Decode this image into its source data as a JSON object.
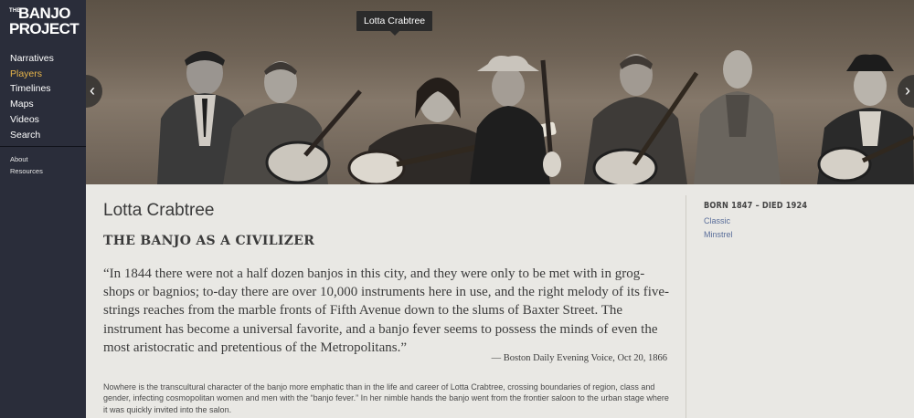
{
  "logo": {
    "the": "THE",
    "line1": "BANJO",
    "line2": "PROJECT"
  },
  "nav": [
    "Narratives",
    "Players",
    "Timelines",
    "Maps",
    "Videos",
    "Search"
  ],
  "nav_active": "Players",
  "subnav": [
    "About",
    "Resources"
  ],
  "banner": {
    "tooltip": "Lotta Crabtree",
    "prev_icon": "chevron-left-icon",
    "next_icon": "chevron-right-icon"
  },
  "player": {
    "name": "Lotta Crabtree",
    "section_title": "THE BANJO AS A CIVILIZER",
    "quote": "“In 1844 there were not a half dozen banjos in this city, and they were only to be met with in grog-shops or bagnios; to-day there are over 10,000 instruments here in use, and the right melody of its five-strings reaches from the marble fronts of Fifth Avenue down to the slums of Baxter Street. The instrument has become a universal favorite, and a banjo fever seems to possess the minds of even the most aristocratic and pretentious of the Metropolitans.”",
    "attribution": "— Boston Daily Evening Voice, Oct 20, 1866",
    "body": "Nowhere is the transcultural character of the banjo more emphatic than in the life and career of Lotta Crabtree, crossing boundaries of region, class and gender, infecting cosmopolitan women and men with the “banjo fever.” In her nimble hands the banjo went from the frontier saloon to the urban stage where it was quickly invited into the salon.",
    "dates": "BORN 1847 – DIED 1924",
    "tags": [
      "Classic",
      "Minstrel"
    ]
  },
  "colors": {
    "sidebar": "#2a2d3a",
    "active": "#e8b54a",
    "link": "#5a6e9a",
    "background": "#e9e8e4"
  }
}
